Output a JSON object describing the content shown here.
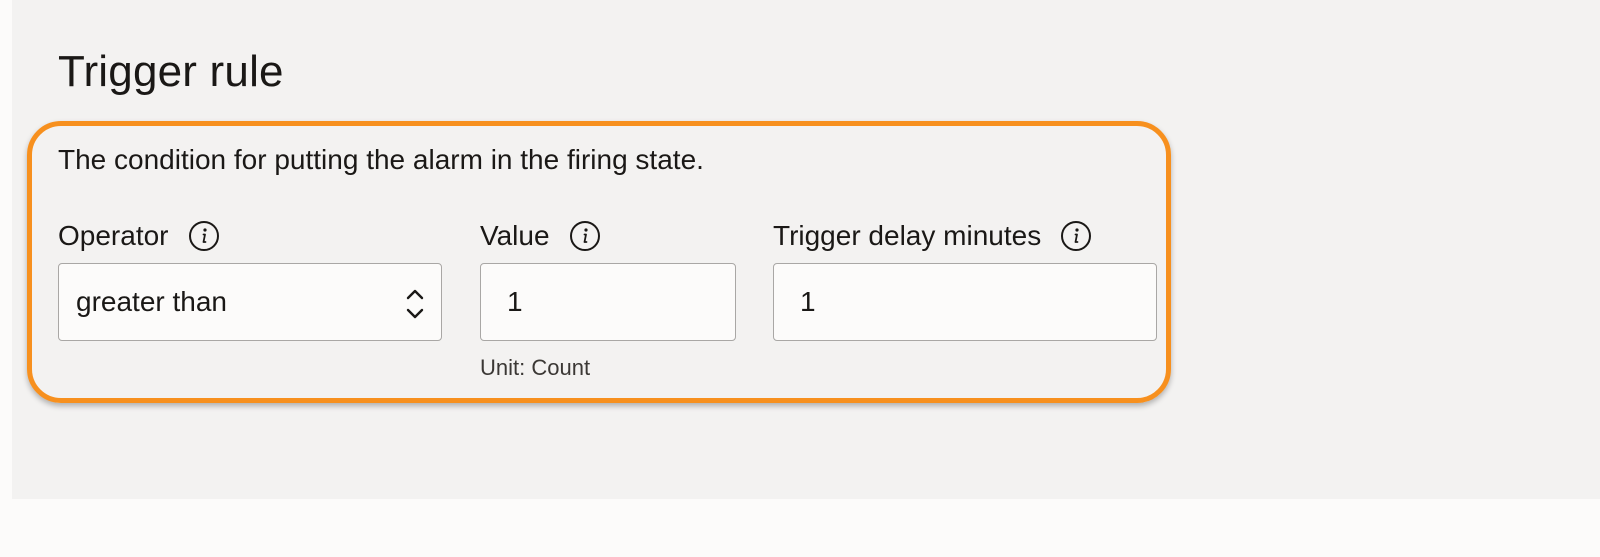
{
  "section": {
    "title": "Trigger rule",
    "description": "The condition for putting the alarm in the firing state."
  },
  "operator": {
    "label": "Operator",
    "icon": "info-icon",
    "selected": "greater than"
  },
  "value": {
    "label": "Value",
    "icon": "info-icon",
    "current": "1",
    "helper": "Unit: Count"
  },
  "trigger_delay": {
    "label": "Trigger delay minutes",
    "icon": "info-icon",
    "current": "1"
  },
  "colors": {
    "highlight": "#f7901e",
    "panel_background": "#f3f2f1",
    "field_border": "#a9a7a5"
  }
}
